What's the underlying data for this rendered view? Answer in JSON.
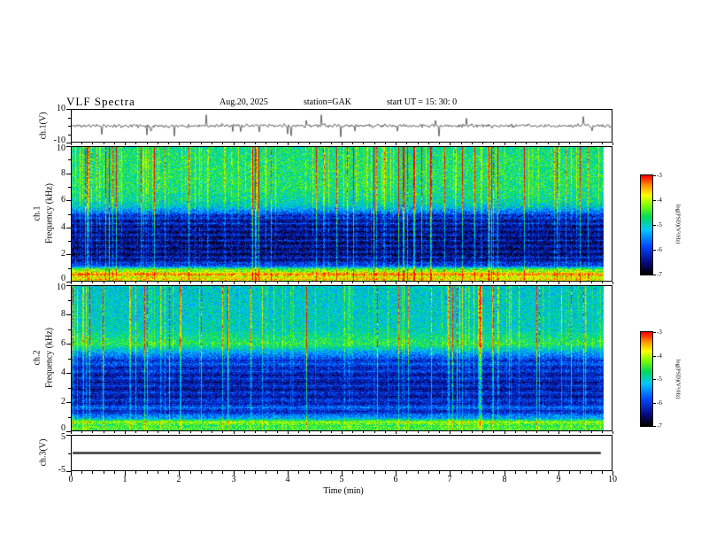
{
  "title": {
    "main": "VLF Spectra",
    "date": "Aug.20, 2025",
    "station": "station=GAK",
    "start": "start UT =  15: 30: 0"
  },
  "xaxis": {
    "label": "Time (min)",
    "ticks": [
      "0",
      "1",
      "2",
      "3",
      "4",
      "5",
      "6",
      "7",
      "8",
      "9",
      "10"
    ],
    "range": [
      0,
      10
    ]
  },
  "panels": {
    "ch1_wave": {
      "ylabel": "ch.1(V)",
      "yticks": [
        "10",
        "-10"
      ],
      "ylim": [
        -10,
        10
      ]
    },
    "ch1_spec": {
      "channel": "ch.1",
      "ylabel": "Frequency (kHz)",
      "yticks": [
        "10",
        "8",
        "6",
        "4",
        "2",
        "0"
      ],
      "ylim": [
        0,
        10
      ]
    },
    "ch2_spec": {
      "channel": "ch.2",
      "ylabel": "Frequency (kHz)",
      "yticks": [
        "10",
        "8",
        "6",
        "4",
        "2",
        "0"
      ],
      "ylim": [
        0,
        10
      ]
    },
    "ch3_wave": {
      "ylabel": "ch.3(V)",
      "yticks": [
        "5",
        "-5"
      ],
      "ylim": [
        -5,
        5
      ]
    }
  },
  "colorbar": {
    "label": "log(PSD)(V²/Hz)",
    "ticks": [
      "-3",
      "-4",
      "-5",
      "-6",
      "-7"
    ],
    "range": [
      -3,
      -7
    ],
    "colors_top_to_bottom": [
      "#ff0000",
      "#ff9600",
      "#ffff00",
      "#82ff00",
      "#00dc5a",
      "#00c8ff",
      "#0046ff",
      "#0a0a82",
      "#000000"
    ]
  },
  "chart_data": [
    {
      "type": "line",
      "name": "ch1_waveform",
      "panel": "ch.1(V)",
      "xlim": [
        0,
        10
      ],
      "ylim": [
        -10,
        10
      ],
      "summary": "Broadband noisy voltage trace centered on 0 V (about ±2 V) with frequent impulsive spikes reaching roughly -8 to +6 V throughout the 10-minute record",
      "noise_sigma": 1.1,
      "spike_prob": 0.04,
      "spike_amp": [
        3,
        8
      ],
      "seed": 11
    },
    {
      "type": "heatmap",
      "name": "ch1_spectrogram",
      "panel": "ch.1 Frequency (kHz)",
      "xlim": [
        0,
        10
      ],
      "ylim": [
        0,
        10
      ],
      "zlim": [
        -7,
        -3
      ],
      "zlabel": "log(PSD)(V²/Hz)",
      "summary": "Dense impulsive vertical sferic striations over the whole record: green background (~-4.7) above 5 kHz with many yellow/red bursts up to -3, dark blue/black (~-6.5) from 1 to 5 kHz crossed by lighter blue striations and fine horizontal lines, and an intense yellow-orange-red band (~-3.6 to -4) near 0.2-0.9 kHz",
      "bands": [
        [
          0,
          -4.2
        ],
        [
          0.2,
          -3.8
        ],
        [
          0.5,
          -3.6
        ],
        [
          0.8,
          -4.1
        ],
        [
          1.0,
          -5.2
        ],
        [
          1.3,
          -6.2
        ],
        [
          2,
          -6.5
        ],
        [
          3,
          -6.5
        ],
        [
          4,
          -6.4
        ],
        [
          4.8,
          -6.2
        ],
        [
          5.2,
          -5.6
        ],
        [
          5.6,
          -5.1
        ],
        [
          6,
          -4.9
        ],
        [
          7,
          -4.7
        ],
        [
          9,
          -4.7
        ],
        [
          10,
          -4.8
        ]
      ],
      "noise": 0.55,
      "impulse_prob": 0.1,
      "impulse_gain": [
        0.35,
        1.1
      ],
      "stripe_fmax": 5,
      "stripe_period": 0.42,
      "stripe_amp": 0.35,
      "events": [],
      "data_end_frac": 0.985,
      "seed": 42
    },
    {
      "type": "heatmap",
      "name": "ch2_spectrogram",
      "panel": "ch.2 Frequency (kHz)",
      "xlim": [
        0,
        10
      ],
      "ylim": [
        0,
        10
      ],
      "zlim": [
        -7,
        -3
      ],
      "zlabel": "log(PSD)(V²/Hz)",
      "summary": "Teal/green background (~-5.1) above 6.5 kHz, bright green-yellow band (~-4.6) near 6 kHz, dark blue (~-6.2) from 1 to 5 kHz with horizontal harmonic lines and vertical striations, yellow-green band (~-4.3) near 0.3-0.7 kHz, and a strong orange-red burst near t=7.55 min",
      "bands": [
        [
          0,
          -4.8
        ],
        [
          0.3,
          -4.4
        ],
        [
          0.6,
          -4.3
        ],
        [
          0.9,
          -5.3
        ],
        [
          1.2,
          -6.1
        ],
        [
          1.6,
          -5.9
        ],
        [
          2,
          -6.2
        ],
        [
          3,
          -6.3
        ],
        [
          4,
          -6.2
        ],
        [
          5,
          -5.9
        ],
        [
          5.5,
          -5.3
        ],
        [
          6,
          -4.6
        ],
        [
          6.5,
          -4.8
        ],
        [
          7,
          -5.0
        ],
        [
          8,
          -5.05
        ],
        [
          10,
          -5.1
        ]
      ],
      "noise": 0.5,
      "impulse_prob": 0.08,
      "impulse_gain": [
        0.3,
        0.9
      ],
      "stripe_fmax": 5,
      "stripe_period": 0.5,
      "stripe_amp": 0.3,
      "events": [
        {
          "t": 7.55,
          "strength": 3.0
        }
      ],
      "data_end_frac": 0.985,
      "seed": 77
    },
    {
      "type": "line",
      "name": "ch3_waveform",
      "panel": "ch.3(V)",
      "xlim": [
        0,
        10
      ],
      "ylim": [
        -5,
        5
      ],
      "summary": "Constant flat trace at 0 V for the entire record, ending near 9.8 min",
      "value": 0,
      "data_end_frac": 0.98,
      "seed": 5
    }
  ]
}
